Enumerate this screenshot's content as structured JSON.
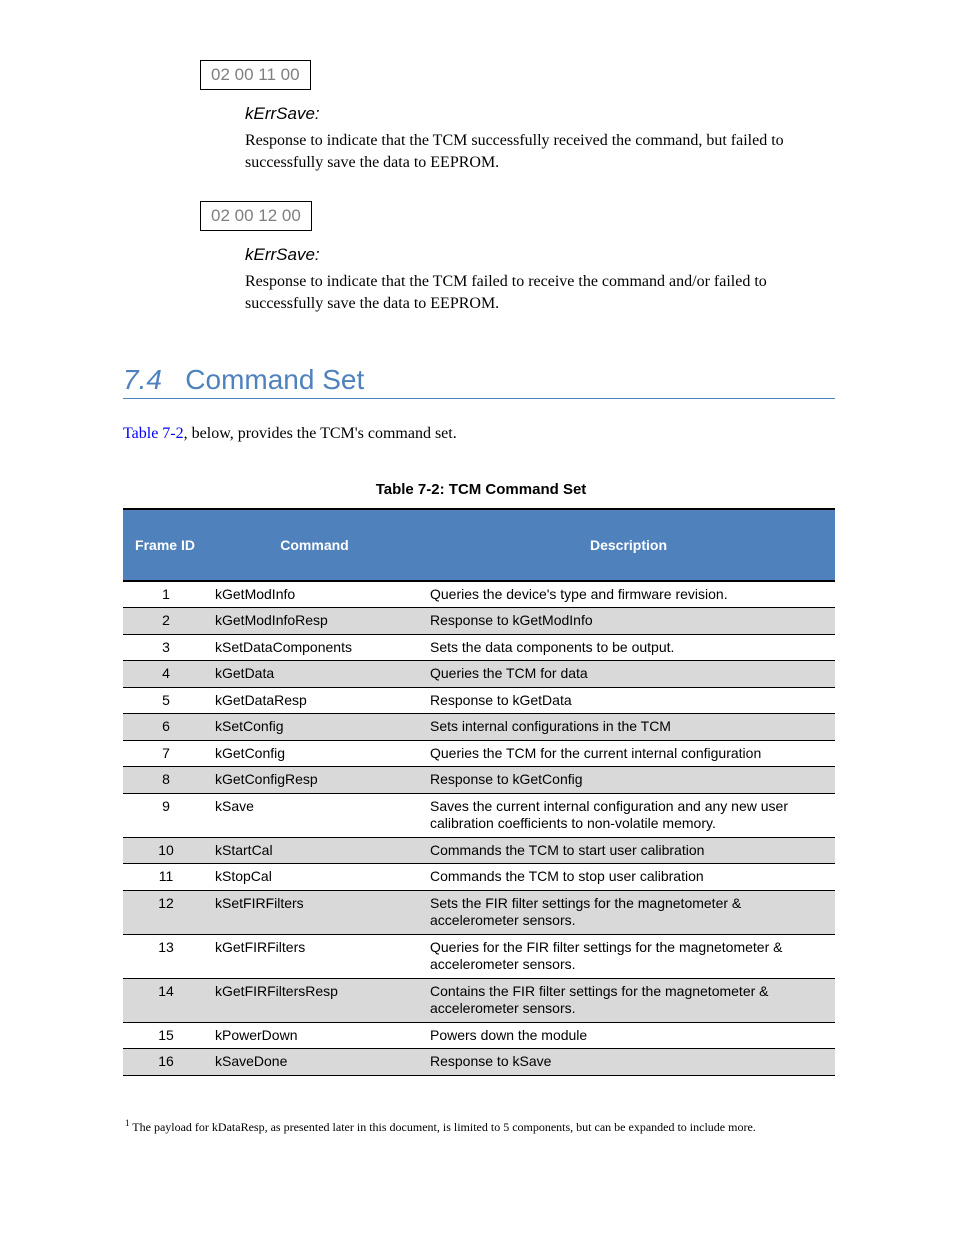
{
  "block1": {
    "datagram": "02 00 11 00",
    "paramLabel": "kErrSave:",
    "paramDesc": "Response to indicate that the TCM successfully received the command, but failed to successfully save the data to EEPROM."
  },
  "block2": {
    "datagram": "02 00 12 00",
    "paramLabel": "kErrSave:",
    "paramDesc": "Response to indicate that the TCM failed to receive the command and/or failed to successfully save the data to EEPROM."
  },
  "heading": {
    "num": "7.4",
    "title": "Command Set"
  },
  "intro": {
    "link": "Table 7-2",
    "rest": ", below, provides the TCM's command set."
  },
  "tableCaption": "Table 7-2: TCM Command Set",
  "headers": {
    "frame": "Frame ID",
    "cmd": "Command",
    "desc": "Description"
  },
  "rows": [
    {
      "id": "1",
      "cmd": "kGetModInfo",
      "desc": "Queries the device's type and firmware revision."
    },
    {
      "id": "2",
      "cmd": "kGetModInfoResp",
      "desc": "Response to kGetModInfo"
    },
    {
      "id": "3",
      "cmd": "kSetDataComponents",
      "desc": "Sets the data components to be output."
    },
    {
      "id": "4",
      "cmd": "kGetData",
      "desc": "Queries the TCM for data"
    },
    {
      "id": "5",
      "cmd": "kGetDataResp",
      "desc": "Response to kGetData"
    },
    {
      "id": "6",
      "cmd": "kSetConfig",
      "desc": "Sets internal configurations in the TCM"
    },
    {
      "id": "7",
      "cmd": "kGetConfig",
      "desc": "Queries the TCM for the current internal configuration"
    },
    {
      "id": "8",
      "cmd": "kGetConfigResp",
      "desc": "Response to kGetConfig"
    },
    {
      "id": "9",
      "cmd": "kSave",
      "desc": "Saves the current internal configuration and any new user calibration coefficients to non-volatile memory."
    },
    {
      "id": "10",
      "cmd": "kStartCal",
      "desc": "Commands the TCM to start user calibration"
    },
    {
      "id": "11",
      "cmd": "kStopCal",
      "desc": "Commands the TCM to stop user calibration"
    },
    {
      "id": "12",
      "cmd": "kSetFIRFilters",
      "desc": "Sets the FIR filter settings for the magnetometer & accelerometer sensors."
    },
    {
      "id": "13",
      "cmd": "kGetFIRFilters",
      "desc": "Queries for the FIR filter settings for the magnetometer & accelerometer sensors."
    },
    {
      "id": "14",
      "cmd": "kGetFIRFiltersResp",
      "desc": "Contains the FIR filter settings for the magnetometer & accelerometer sensors."
    },
    {
      "id": "15",
      "cmd": "kPowerDown",
      "desc": "Powers down the module"
    },
    {
      "id": "16",
      "cmd": "kSaveDone",
      "desc": "Response to kSave"
    }
  ],
  "footnote": {
    "marker": "1",
    "text": " The payload for kDataResp, as presented later in this document, is limited to 5 components, but can be expanded to include more."
  }
}
